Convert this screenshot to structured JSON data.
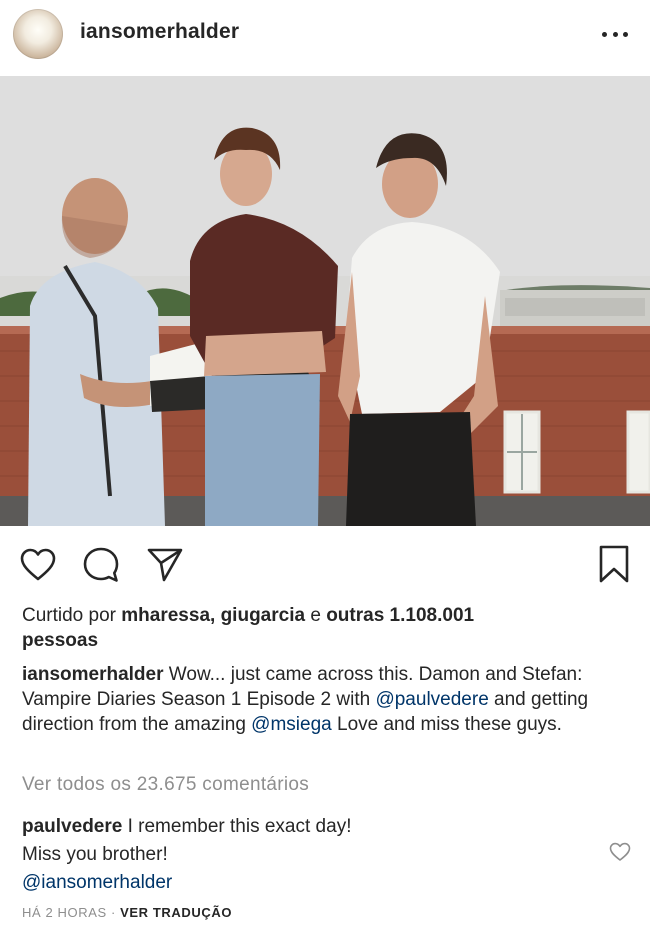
{
  "header": {
    "username": "iansomerhalder",
    "more_icon": "more-horizontal-icon"
  },
  "actions": {
    "like_icon": "heart-icon",
    "comment_icon": "comment-icon",
    "share_icon": "send-icon",
    "save_icon": "bookmark-icon"
  },
  "likes": {
    "prefix": "Curtido por",
    "user1": "mharessa",
    "user2": "giugarcia",
    "conj": "e",
    "others": "outras 1.108.001",
    "suffix": "pessoas"
  },
  "caption": {
    "username": "iansomerhalder",
    "text1": "Wow... just came across this. Damon and Stefan: Vampire Diaries Season 1 Episode 2 with",
    "mention1": "@paulvedere",
    "text2": "and getting direction from the amazing",
    "mention2": "@msiega",
    "text3": "Love and miss these guys."
  },
  "view_all": "Ver todos os 23.675 comentários",
  "comment": {
    "username": "paulvedere",
    "text1": "I remember this exact day!",
    "text2": "Miss you brother!",
    "mention": "@iansomerhalder"
  },
  "footer": {
    "time": "HÁ 2 HORAS",
    "separator": "·",
    "translate": "VER TRADUÇÃO"
  },
  "colors": {
    "text": "#262626",
    "secondary": "#8e8e8e",
    "link": "#003569"
  }
}
